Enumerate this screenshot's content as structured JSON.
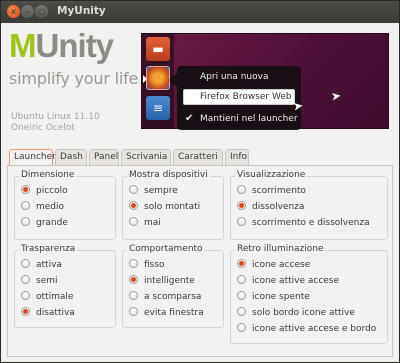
{
  "window": {
    "title": "MyUnity",
    "close_glyph": "×",
    "min_glyph": "–",
    "max_glyph": "□"
  },
  "header": {
    "logo_initial": "M",
    "logo_rest": "Unity",
    "tagline": "simplify your life",
    "os_name": "Ubuntu Linux 11.10",
    "os_codename": "Oneiric Ocelot"
  },
  "preview": {
    "quicklist": {
      "open_new_window": "Apri una nuova finestra",
      "app_name": "Firefox Browser Web",
      "keep_in_launcher": "Mantieni nel launcher",
      "check_glyph": "✔"
    },
    "icons": [
      "files-icon",
      "firefox-icon",
      "document-icon"
    ],
    "accent_color": "#dd4814"
  },
  "tabs": [
    {
      "label": "Launcher",
      "active": true
    },
    {
      "label": "Dash",
      "active": false
    },
    {
      "label": "Panel",
      "active": false
    },
    {
      "label": "Scrivania",
      "active": false
    },
    {
      "label": "Caratteri",
      "active": false
    },
    {
      "label": "Info",
      "active": false
    }
  ],
  "launcher": {
    "dimensione": {
      "title": "Dimensione",
      "options": [
        "piccolo",
        "medio",
        "grande"
      ],
      "selected": 0
    },
    "mostra_dispositivi": {
      "title": "Mostra dispositivi",
      "options": [
        "sempre",
        "solo montati",
        "mai"
      ],
      "selected": 1
    },
    "visualizzazione": {
      "title": "Visualizzazione",
      "options": [
        "scorrimento",
        "dissolvenza",
        "scorrimento e dissolvenza"
      ],
      "selected": 1
    },
    "trasparenza": {
      "title": "Trasparenza",
      "options": [
        "attiva",
        "semi",
        "ottimale",
        "disattiva"
      ],
      "selected": 3
    },
    "comportamento": {
      "title": "Comportamento",
      "options": [
        "fisso",
        "intelligente",
        "a scomparsa",
        "evita finestra"
      ],
      "selected": 1
    },
    "retro_illuminazione": {
      "title": "Retro illuminazione",
      "options": [
        "icone accese",
        "icone attive accese",
        "icone spente",
        "solo bordo icone attive",
        "icone attive accese e bordo"
      ],
      "selected": 0
    }
  }
}
